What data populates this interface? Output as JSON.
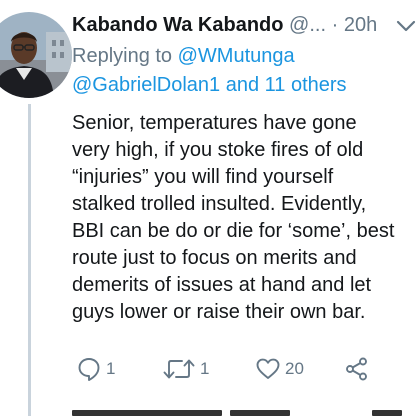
{
  "tweet": {
    "display_name": "Kabando Wa Kabando",
    "handle": "@...",
    "separator": "·",
    "timestamp": "20h",
    "replying_prefix": "Replying to",
    "mention_1": "@WMutunga",
    "mention_2": "@GabrielDolan1",
    "mention_joiner": "and",
    "mention_others": "11 others",
    "text_lines": [
      "Senior, temperatures have gone",
      "very high, if you stoke fires of old",
      "“injuries” you will find yourself",
      "stalked trolled insulted. Evidently,",
      "BBI can be do or die for ‘some’, best",
      "route just to focus on merits and",
      "demerits of issues at hand and let",
      "guys lower or raise their own bar."
    ]
  },
  "actions": {
    "reply_count": "1",
    "retweet_count": "1",
    "like_count": "20",
    "reply_icon": "comment-icon",
    "retweet_icon": "retweet-icon",
    "like_icon": "heart-icon",
    "share_icon": "share-icon"
  },
  "colors": {
    "text": "#14171a",
    "secondary": "#657786",
    "link": "#1b95e0",
    "thread_line": "#c9d3dc"
  }
}
